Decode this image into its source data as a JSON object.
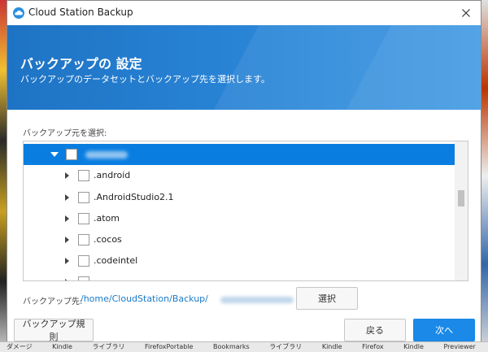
{
  "window": {
    "title": "Cloud Station Backup"
  },
  "icons": {
    "app": "cloud-icon",
    "close": "close-icon",
    "expand": "expand-arrow-icon",
    "collapse": "collapse-arrow-icon"
  },
  "banner": {
    "title": "バックアップの 設定",
    "subtitle": "バックアップのデータセットとバックアップ先を選択します。"
  },
  "source": {
    "label": "バックアップ元を選択:",
    "items": [
      ".android",
      ".AndroidStudio2.1",
      ".atom",
      ".cocos",
      ".codeintel"
    ]
  },
  "destination": {
    "label": "バックアップ先:",
    "path": "/home/CloudStation/Backup/",
    "select_button": "選択"
  },
  "footer": {
    "rules_button": "バックアップ規則",
    "back_button": "戻る",
    "next_button": "次へ"
  },
  "taskbar": {
    "items": [
      "ダメージ",
      "Kindle",
      "ライブラリ",
      "FirefoxPortable",
      "Bookmarks",
      "ライブラリ",
      "Kindle",
      "Firefox",
      "Kindle",
      "Previewer"
    ]
  },
  "colors": {
    "accent": "#1a89e8",
    "banner": "#2b86d8",
    "selection": "#0a7ee0",
    "path": "#1a7bc8"
  }
}
